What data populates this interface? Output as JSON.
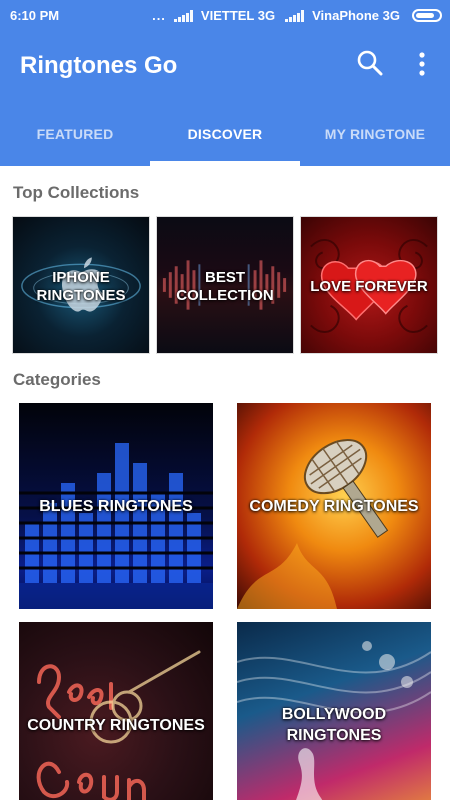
{
  "status": {
    "time": "6:10 PM",
    "dots": "...",
    "carrier1": "VIETTEL 3G",
    "carrier2": "VinaPhone 3G"
  },
  "appbar": {
    "title": "Ringtones Go",
    "search_icon": "search-icon",
    "more_icon": "more-vert-icon",
    "color": "#4a86e8"
  },
  "tabs": [
    {
      "label": "FEATURED",
      "active": false
    },
    {
      "label": "DISCOVER",
      "active": true
    },
    {
      "label": "MY RINGTONE",
      "active": false
    }
  ],
  "top_collections": {
    "title": "Top Collections",
    "items": [
      {
        "label_line1": "IPHONE",
        "label_line2": "RINGTONES"
      },
      {
        "label_line1": "BEST",
        "label_line2": "COLLECTION"
      },
      {
        "label_line1": "LOVE FOREVER",
        "label_line2": ""
      }
    ]
  },
  "categories": {
    "title": "Categories",
    "items": [
      {
        "label_line1": "BLUES RINGTONES",
        "label_line2": ""
      },
      {
        "label_line1": "COMEDY RINGTONES",
        "label_line2": ""
      },
      {
        "label_line1": "COUNTRY RINGTONES",
        "label_line2": ""
      },
      {
        "label_line1": "BOLLYWOOD",
        "label_line2": "RINGTONES"
      }
    ]
  }
}
